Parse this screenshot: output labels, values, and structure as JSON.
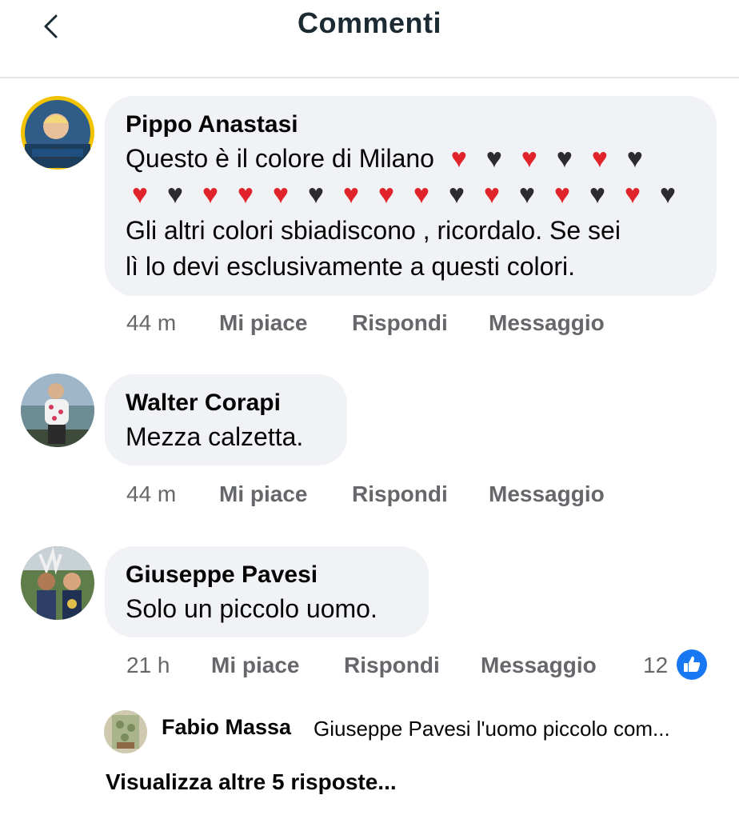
{
  "header": {
    "title": "Commenti"
  },
  "comments": [
    {
      "author": "Pippo Anastasi",
      "text_line1": "Questo è il colore di Milano",
      "hearts_line1": [
        "red",
        "black",
        "red",
        "black",
        "red",
        "black"
      ],
      "hearts_line2": [
        "red",
        "black",
        "red",
        "red",
        "red",
        "black",
        "red",
        "red",
        "red",
        "black",
        "red",
        "black",
        "red",
        "black",
        "red",
        "black"
      ],
      "text_line3": "Gli altri colori sbiadiscono , ricordalo. Se sei",
      "text_line4": "lì lo devi esclusivamente a questi colori.",
      "time": "44 m",
      "like_label": "Mi piace",
      "reply_label": "Rispondi",
      "message_label": "Messaggio",
      "avatar_badge": "#StandWithUkraine"
    },
    {
      "author": "Walter Corapi",
      "text": "Mezza calzetta.",
      "time": "44 m",
      "like_label": "Mi piace",
      "reply_label": "Rispondi",
      "message_label": "Messaggio"
    },
    {
      "author": "Giuseppe Pavesi",
      "text": "Solo un piccolo uomo.",
      "time": "21 h",
      "like_label": "Mi piace",
      "reply_label": "Rispondi",
      "message_label": "Messaggio",
      "reaction_count": "12",
      "reaction_icon": "like-icon"
    }
  ],
  "reply_preview": {
    "author": "Fabio Massa",
    "text": "Giuseppe Pavesi l'uomo piccolo com..."
  },
  "more_replies_label": "Visualizza altre 5 risposte...",
  "colors": {
    "bubble": "#f0f2f5",
    "secondary_text": "#65676b",
    "like_blue": "#1877f2",
    "heart_red": "#e1242b",
    "heart_black": "#2c2c2e"
  }
}
